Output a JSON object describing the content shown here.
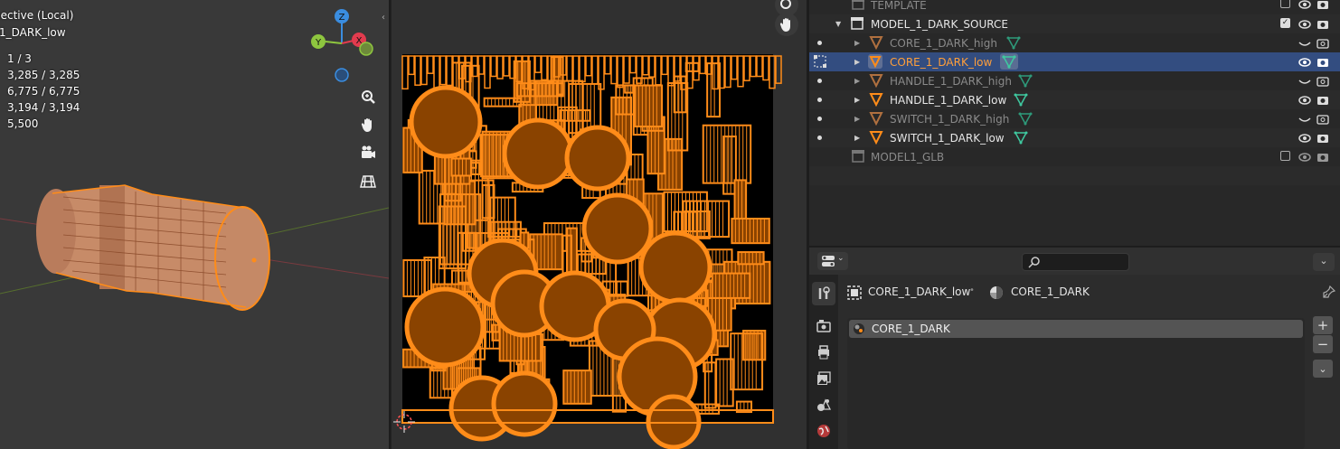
{
  "viewport": {
    "title": "pective (Local)",
    "object_name": "_1_DARK_low",
    "stats": [
      "1 / 3",
      "3,285 / 3,285",
      "6,775 / 6,775",
      "3,194 / 3,194",
      "5,500"
    ],
    "gizmo": {
      "x": "X",
      "y": "Y",
      "z": "Z"
    }
  },
  "outliner": {
    "rows": [
      {
        "label": "TEMPLATE",
        "type": "collection",
        "dim": true
      },
      {
        "label": "MODEL_1_DARK_SOURCE",
        "type": "collection",
        "dim": false
      },
      {
        "label": "CORE_1_DARK_high",
        "type": "mesh",
        "dim": true
      },
      {
        "label": "CORE_1_DARK_low",
        "type": "mesh",
        "dim": false,
        "selected": true
      },
      {
        "label": "HANDLE_1_DARK_high",
        "type": "mesh",
        "dim": true
      },
      {
        "label": "HANDLE_1_DARK_low",
        "type": "mesh",
        "dim": false
      },
      {
        "label": "SWITCH_1_DARK_high",
        "type": "mesh",
        "dim": true
      },
      {
        "label": "SWITCH_1_DARK_low",
        "type": "mesh",
        "dim": false
      },
      {
        "label": "MODEL1_GLB",
        "type": "collection",
        "dim": true
      }
    ]
  },
  "properties": {
    "breadcrumb_object": "CORE_1_DARK_low",
    "breadcrumb_material": "CORE_1_DARK",
    "material_slots": [
      "CORE_1_DARK"
    ]
  },
  "colors": {
    "accent_orange": "#ff8c19",
    "selection_blue": "#334d80",
    "mesh_green": "#3fc9a0",
    "axis_x": "#e23b4e",
    "axis_y": "#8ec63f",
    "axis_z": "#3a8de0"
  }
}
